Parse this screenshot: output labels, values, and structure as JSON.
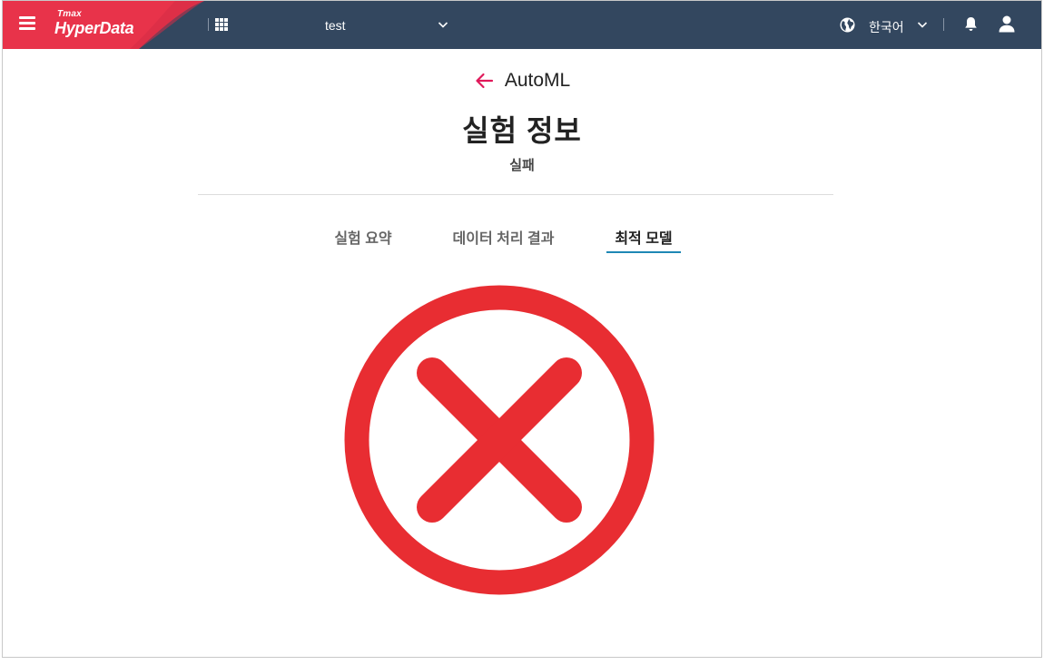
{
  "topbar": {
    "logo_small": "Tmax",
    "logo_big": "HyperData",
    "project_value": "test",
    "language_value": "한국어",
    "icons": [
      "menu-icon",
      "apps-grid-icon",
      "chevron-down-icon",
      "globe-icon",
      "bell-icon",
      "user-icon"
    ]
  },
  "header": {
    "breadcrumb": "AutoML",
    "title": "실험 정보",
    "status": "실패"
  },
  "tabs": [
    {
      "label": "실험 요약",
      "active": false
    },
    {
      "label": "데이터 처리 결과",
      "active": false
    },
    {
      "label": "최적 모델",
      "active": true
    }
  ],
  "colors": {
    "topbar": "#33475f",
    "brand_red": "#e8334a",
    "accent_pink": "#e0195a",
    "tab_underline": "#1e88b5",
    "fail_red": "#e82d32"
  },
  "main": {
    "icon": "fail-x-circle-icon"
  }
}
